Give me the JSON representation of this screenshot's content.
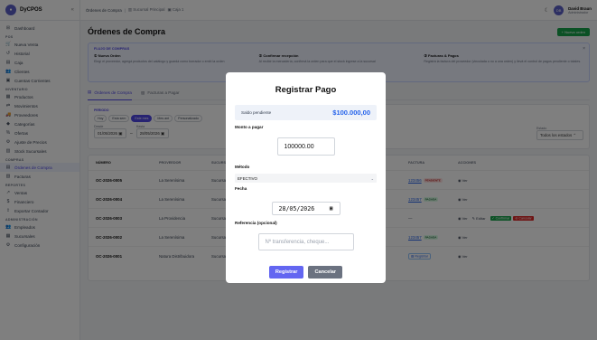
{
  "app": {
    "name": "DyCPOS",
    "collapse_icon": "«"
  },
  "sidebar": {
    "items": [
      {
        "label": "Dashboard",
        "icon": "⊞"
      },
      {
        "section": "POS"
      },
      {
        "label": "Nueva Venta",
        "icon": "🛒"
      },
      {
        "label": "Historial",
        "icon": "↺"
      },
      {
        "label": "Caja",
        "icon": "▤"
      },
      {
        "label": "Clientes",
        "icon": "👥"
      },
      {
        "label": "Cuentas Corrientes",
        "icon": "▣"
      },
      {
        "section": "INVENTARIO"
      },
      {
        "label": "Productos",
        "icon": "▦"
      },
      {
        "label": "Movimientos",
        "icon": "⇄"
      },
      {
        "label": "Proveedores",
        "icon": "🚚"
      },
      {
        "label": "Categorías",
        "icon": "◆"
      },
      {
        "label": "Ofertas",
        "icon": "%"
      },
      {
        "label": "Ajuste de Precios",
        "icon": "⚙"
      },
      {
        "label": "Stock Sucursales",
        "icon": "▥"
      },
      {
        "section": "COMPRAS"
      },
      {
        "label": "Órdenes de Compra",
        "icon": "▤",
        "active": true
      },
      {
        "label": "Facturas",
        "icon": "▧"
      },
      {
        "section": "REPORTES"
      },
      {
        "label": "Ventas",
        "icon": "↗"
      },
      {
        "label": "Financiero",
        "icon": "$"
      },
      {
        "label": "Exportar Contador",
        "icon": "⇪"
      },
      {
        "section": "ADMINISTRACIÓN"
      },
      {
        "label": "Empleados",
        "icon": "👥"
      },
      {
        "label": "Sucursales",
        "icon": "▦"
      },
      {
        "label": "Configuración",
        "icon": "⚙"
      }
    ]
  },
  "topbar": {
    "breadcrumb": [
      "Órdenes de Compra",
      "|",
      "Sucursal Principal",
      "Caja 1"
    ],
    "user_initials": "DB",
    "user_name": "David Braun",
    "user_role": "Administrador"
  },
  "page": {
    "title": "Órdenes de Compra",
    "new_button": "+ Nueva orden",
    "flow": {
      "title": "FLUJO DE COMPRAS",
      "col1_title": "① Nueva Orden",
      "col1_text": "Elegí el proveedor, agregá productos del catálogo y guardá como borrador o emití la orden",
      "col2_title": "② Confirmar recepción",
      "col2_text": "Al recibir la mercadería, confirmá la orden para que el stock ingrese a la sucursal",
      "col3_title": "③ Facturas & Pagos",
      "col3_text": "Registrá la factura del proveedor (vinculada o no a una orden) y llevá el control de pagos pendiente o totales."
    },
    "tabs": [
      {
        "label": "Órdenes de Compra",
        "active": true
      },
      {
        "label": "Facturas a Pagar"
      }
    ],
    "filters": {
      "label": "PERIODO",
      "chips": [
        "Hoy",
        "Esta sem",
        "Este mes",
        "Mes ant",
        "Personalizado"
      ],
      "active_chip": "Este mes",
      "desde_label": "Desde",
      "desde": "01/05/2026",
      "hasta_label": "Hasta",
      "hasta": "28/05/2026",
      "estado_label": "Estado",
      "estado": "Todos los estados"
    },
    "table": {
      "headers": [
        "NÚMERO",
        "PROVEEDOR",
        "SUCURS",
        "FACTURA",
        "ACCIONES"
      ],
      "rows": [
        {
          "num": "OC-2026-0005",
          "prov": "La Serenísima",
          "suc": "Sucursal",
          "fact": "123456",
          "badge": "PENDIENTE",
          "bclass": "b-pend",
          "acts": "ver"
        },
        {
          "num": "OC-2026-0004",
          "prov": "La Serenísima",
          "suc": "Sucursal",
          "fact": "123457",
          "badge": "PAGADA",
          "bclass": "b-paid",
          "acts": "ver"
        },
        {
          "num": "OC-2026-0003",
          "prov": "La Providencia",
          "suc": "Sucursal",
          "fact": "—",
          "badge": "",
          "bclass": "",
          "acts": "full"
        },
        {
          "num": "OC-2026-0002",
          "prov": "La Serenísima",
          "suc": "Sucursal",
          "fact": "123457",
          "badge": "PAGADA",
          "bclass": "b-paid",
          "acts": "ver"
        },
        {
          "num": "OC-2026-0001",
          "prov": "Natura Distribuidora",
          "suc": "Sucursal",
          "fact": "Registrar",
          "badge": "",
          "bclass": "",
          "acts": "ver"
        }
      ],
      "ver": "Ver",
      "editar": "Editar",
      "confirmar": "Confirmar",
      "cancelar": "Cancelar"
    }
  },
  "modal": {
    "title": "Registrar Pago",
    "saldo_label": "Saldo pendiente",
    "saldo_value": "$100.000,00",
    "monto_label": "Monto a pagar",
    "monto_value": "100000.00",
    "metodo_label": "Método",
    "metodo_value": "EFECTIVO",
    "fecha_label": "Fecha",
    "fecha_value": "28/05/2026",
    "ref_label": "Referencia (opcional)",
    "ref_placeholder": "Nº transferencia, cheque...",
    "submit": "Registrar",
    "cancel": "Cancelar"
  }
}
